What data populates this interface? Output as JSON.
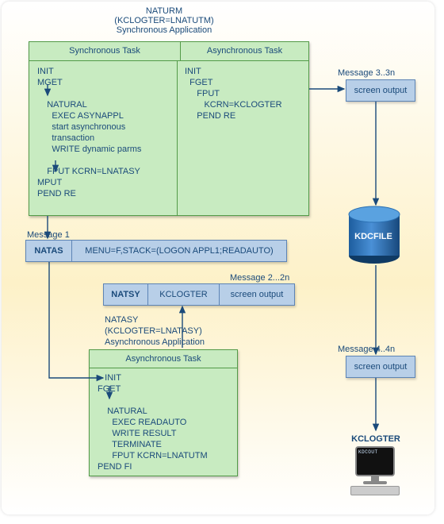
{
  "colors": {
    "line": "#1a4a7a",
    "green_border": "#539a48",
    "green_fill": "#c8ebc1",
    "blue_border": "#5d84b5",
    "blue_fill": "#b8cfe8",
    "cylinder_fill": "#2a6fb2"
  },
  "title": {
    "l1": "NATURM",
    "l2": "(KCLOGTER=LNATUTM)",
    "l3": "Synchronous Application"
  },
  "sync_box": {
    "header_left": "Synchronous Task",
    "header_right": "Asynchronous Task",
    "left_code": "INIT\nMGET\n\n    NATURAL\n      EXEC ASYNAPPL\n      start asynchronous\n      transaction\n      WRITE dynamic parms\n\n    FPUT KCRN=LNATASY\nMPUT\nPEND RE",
    "right_code": "INIT\n  FGET\n     FPUT\n        KCRN=KCLOGTER\n     PEND RE"
  },
  "msg1": {
    "label": "Message 1",
    "cell1": "NATAS",
    "cell2": "MENU=F,STACK=(LOGON APPL1;READAUTO)"
  },
  "msg2": {
    "label": "Message 2...2n",
    "cell1": "NATSY",
    "cell2": "KCLOGTER",
    "cell3": "screen output"
  },
  "async_app": {
    "l1": "NATASY",
    "l2": "(KCLOGTER=LNATASY)",
    "l3": "Asynchronous Application"
  },
  "async_box": {
    "header": "Asynchronous Task",
    "code": "   INIT\nFGET\n\n    NATURAL\n      EXEC READAUTO\n      WRITE RESULT\n      TERMINATE\n      FPUT KCRN=LNATUTM\nPEND FI"
  },
  "right_side": {
    "msg3": "Message 3..3n",
    "screen_out_top": "screen output",
    "kdcfile": "KDCFILE",
    "msg4": "Message 4..4n",
    "screen_out_bottom": "screen output",
    "kclogter": "KCLOGTER",
    "kdcout": "KDCOUT"
  }
}
